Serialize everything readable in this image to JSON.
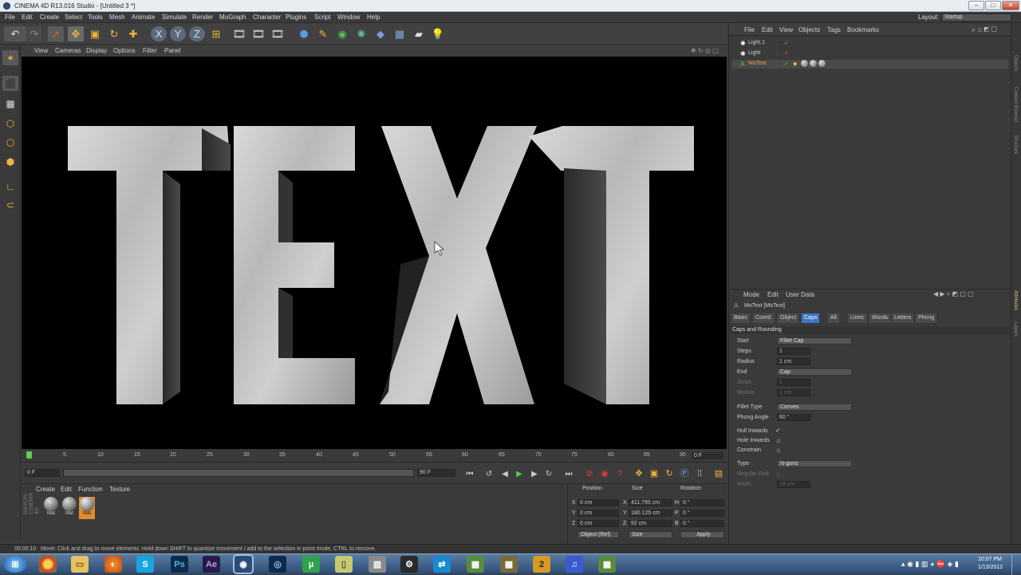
{
  "window": {
    "title": "CINEMA 4D R13.016 Studio - [Untitled 3 *]"
  },
  "menubar": {
    "items": [
      "File",
      "Edit",
      "Create",
      "Select",
      "Tools",
      "Mesh",
      "Animate",
      "Simulate",
      "Render",
      "MoGraph",
      "Character",
      "Plugins",
      "Script",
      "Window",
      "Help"
    ],
    "layout_label": "Layout:",
    "layout_value": "Startup"
  },
  "viewport": {
    "menu": [
      "View",
      "Cameras",
      "Display",
      "Options",
      "Filter",
      "Panel"
    ],
    "text_letters": [
      "T",
      "E",
      "X",
      "T"
    ]
  },
  "timeline": {
    "ticks": [
      "0",
      "5",
      "10",
      "15",
      "20",
      "25",
      "30",
      "35",
      "40",
      "45",
      "50",
      "55",
      "60",
      "65",
      "70",
      "75",
      "80",
      "85",
      "90"
    ],
    "current_frame": "0 F",
    "start_field": "0 F",
    "end_field": "90 F",
    "end_marker": "90 F"
  },
  "material_manager": {
    "menu": [
      "Create",
      "Edit",
      "Function",
      "Texture"
    ],
    "materials": [
      "Mat",
      "Mat",
      "Mat"
    ]
  },
  "coordinates": {
    "headers": [
      "Position",
      "Size",
      "Rotation"
    ],
    "rows": [
      {
        "axis": "X",
        "pos": "0 cm",
        "size_axis": "X",
        "size": "411.795 cm",
        "rot_axis": "H",
        "rot": "0 °"
      },
      {
        "axis": "Y",
        "pos": "0 cm",
        "size_axis": "Y",
        "size": "180.125 cm",
        "rot_axis": "P",
        "rot": "0 °"
      },
      {
        "axis": "Z",
        "pos": "0 cm",
        "size_axis": "Z",
        "size": "92 cm",
        "rot_axis": "B",
        "rot": "0 °"
      }
    ],
    "mode_dropdown": "Object (Rel)",
    "size_dropdown": "Size",
    "apply_label": "Apply"
  },
  "object_manager": {
    "menu": [
      "File",
      "Edit",
      "View",
      "Objects",
      "Tags",
      "Bookmarks"
    ],
    "objects": [
      "Light.1",
      "Light",
      "MoText"
    ]
  },
  "attribute_manager": {
    "menu": [
      "Mode",
      "Edit",
      "User Data"
    ],
    "object_label": "MoText [MoText]",
    "tabs": [
      "Basic",
      "Coord.",
      "Object",
      "Caps",
      "All",
      "Lines",
      "Words",
      "Letters",
      "Phong"
    ],
    "active_tab": "Caps",
    "section_title": "Caps and Rounding",
    "start_label": "Start",
    "start_value": "Fillet Cap",
    "steps_label": "Steps",
    "steps_value": "1",
    "radius_label": "Radius",
    "radius_value": "1 cm",
    "end_label": "End",
    "end_value": "Cap",
    "steps2_label": "Steps",
    "steps2_value": "1",
    "radius2_label": "Radius",
    "radius2_value": "1 cm",
    "fillet_type_label": "Fillet Type",
    "fillet_type_value": "Convex",
    "phong_angle_label": "Phong Angle",
    "phong_angle_value": "60 °",
    "hull_inwards_label": "Hull Inwards",
    "hole_inwards_label": "Hole Inwards",
    "constrain_label": "Constrain",
    "type_label": "Type",
    "type_value": "N-gons",
    "regular_grid_label": "Regular Grid",
    "width_label": "Width",
    "width_value": "10 cm"
  },
  "right_strip": {
    "labels": [
      "Objects",
      "Content Browser",
      "Structure",
      "Attributes",
      "Layers"
    ]
  },
  "status": {
    "time": "00:00:10",
    "message": "Move: Click and drag to move elements. Hold down SHIFT to quantize movement / add to the selection in point mode, CTRL to remove."
  },
  "taskbar": {
    "time": "10:07 PM",
    "date": "1/13/2012"
  },
  "maxon_label": "MAXON CINEMA 4D"
}
